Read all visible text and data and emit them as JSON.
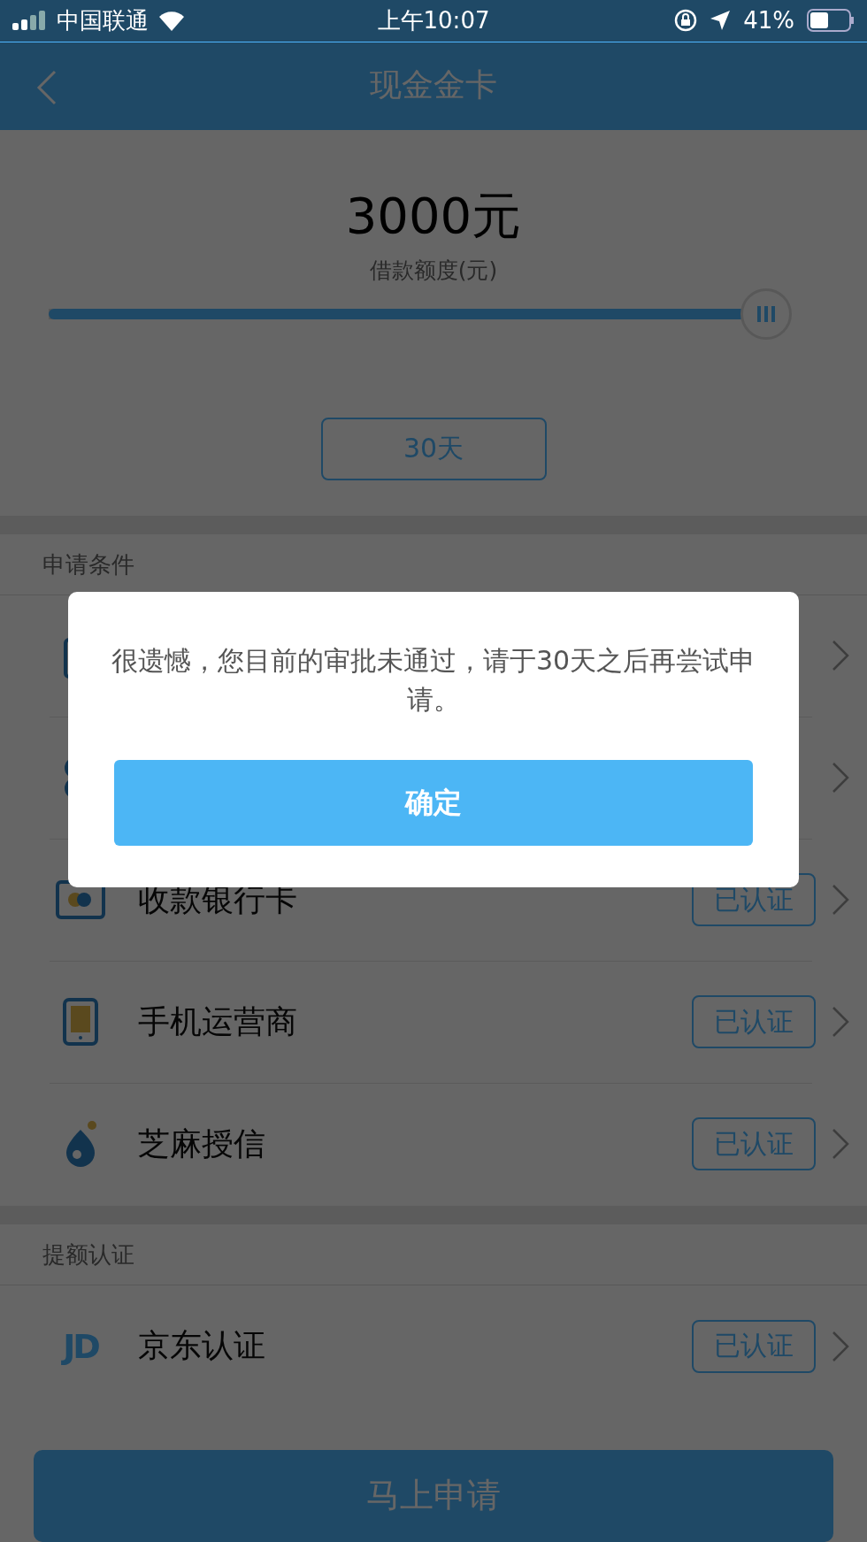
{
  "status_bar": {
    "carrier": "中国联通",
    "time": "上午10:07",
    "battery": "41%"
  },
  "nav": {
    "title": "现金金卡"
  },
  "loan": {
    "amount": "3000元",
    "label": "借款额度(元)",
    "slider": {
      "level": 1
    },
    "term": "30天"
  },
  "sections": [
    {
      "title": "申请条件",
      "rows": [
        {
          "kind": "id-card"
        },
        {
          "kind": "contacts"
        },
        {
          "kind": "bank-card",
          "title": "收款银行卡",
          "badge": "已认证"
        },
        {
          "kind": "phone",
          "title": "手机运营商",
          "badge": "已认证"
        },
        {
          "kind": "sesame",
          "title": "芝麻授信",
          "badge": "已认证"
        }
      ]
    },
    {
      "title": "提额认证",
      "rows": [
        {
          "kind": "jd",
          "logo_text": "JD",
          "title": "京东认证",
          "badge": "已认证"
        }
      ]
    }
  ],
  "apply_button": "马上申请",
  "dialog": {
    "message": "很遗憾，您目前的审批未通过，请于30天之后再尝试申请。",
    "confirm": "确定"
  }
}
